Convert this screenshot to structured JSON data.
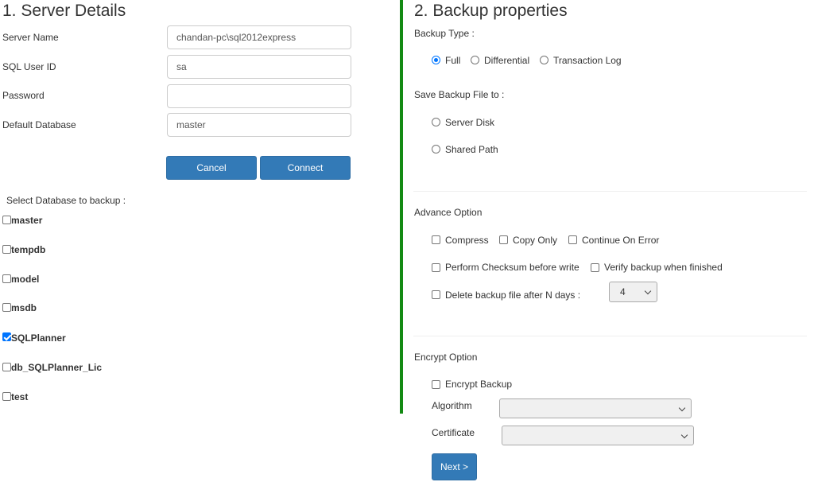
{
  "server_details": {
    "heading": "1. Server Details",
    "server_name_label": "Server Name",
    "server_name_value": "chandan-pc\\sql2012express",
    "user_id_label": "SQL User ID",
    "user_id_value": "sa",
    "password_label": "Password",
    "password_value": "",
    "default_db_label": "Default Database",
    "default_db_value": "master",
    "cancel_label": "Cancel",
    "connect_label": "Connect",
    "select_db_label": "Select Database to backup :",
    "databases": [
      {
        "name": "master",
        "checked": false
      },
      {
        "name": "tempdb",
        "checked": false
      },
      {
        "name": "model",
        "checked": false
      },
      {
        "name": "msdb",
        "checked": false
      },
      {
        "name": "SQLPlanner",
        "checked": true
      },
      {
        "name": "db_SQLPlanner_Lic",
        "checked": false
      },
      {
        "name": "test",
        "checked": false
      }
    ]
  },
  "backup_properties": {
    "heading": "2. Backup properties",
    "backup_type_label": "Backup Type :",
    "backup_types": {
      "full": "Full",
      "differential": "Differential",
      "transaction_log": "Transaction Log",
      "selected": "Full"
    },
    "save_to_label": "Save Backup File to :",
    "save_to": {
      "server_disk": "Server Disk",
      "shared_path": "Shared Path"
    },
    "advance_option_label": "Advance Option",
    "advance_options": {
      "compress": "Compress",
      "copy_only": "Copy Only",
      "continue_on_error": "Continue On Error",
      "perform_checksum": "Perform Checksum before write",
      "verify_backup": "Verify backup when finished",
      "delete_after_days": "Delete backup file after N days :",
      "days_value": "4"
    },
    "encrypt_option_label": "Encrypt Option",
    "encrypt": {
      "encrypt_backup": "Encrypt Backup",
      "algorithm_label": "Algorithm",
      "algorithm_value": "",
      "certificate_label": "Certificate",
      "certificate_value": ""
    },
    "next_label": "Next >"
  },
  "colors": {
    "primary_button": "#337ab7",
    "divider_green": "#138a13",
    "checkbox_accent": "#0075ff"
  }
}
